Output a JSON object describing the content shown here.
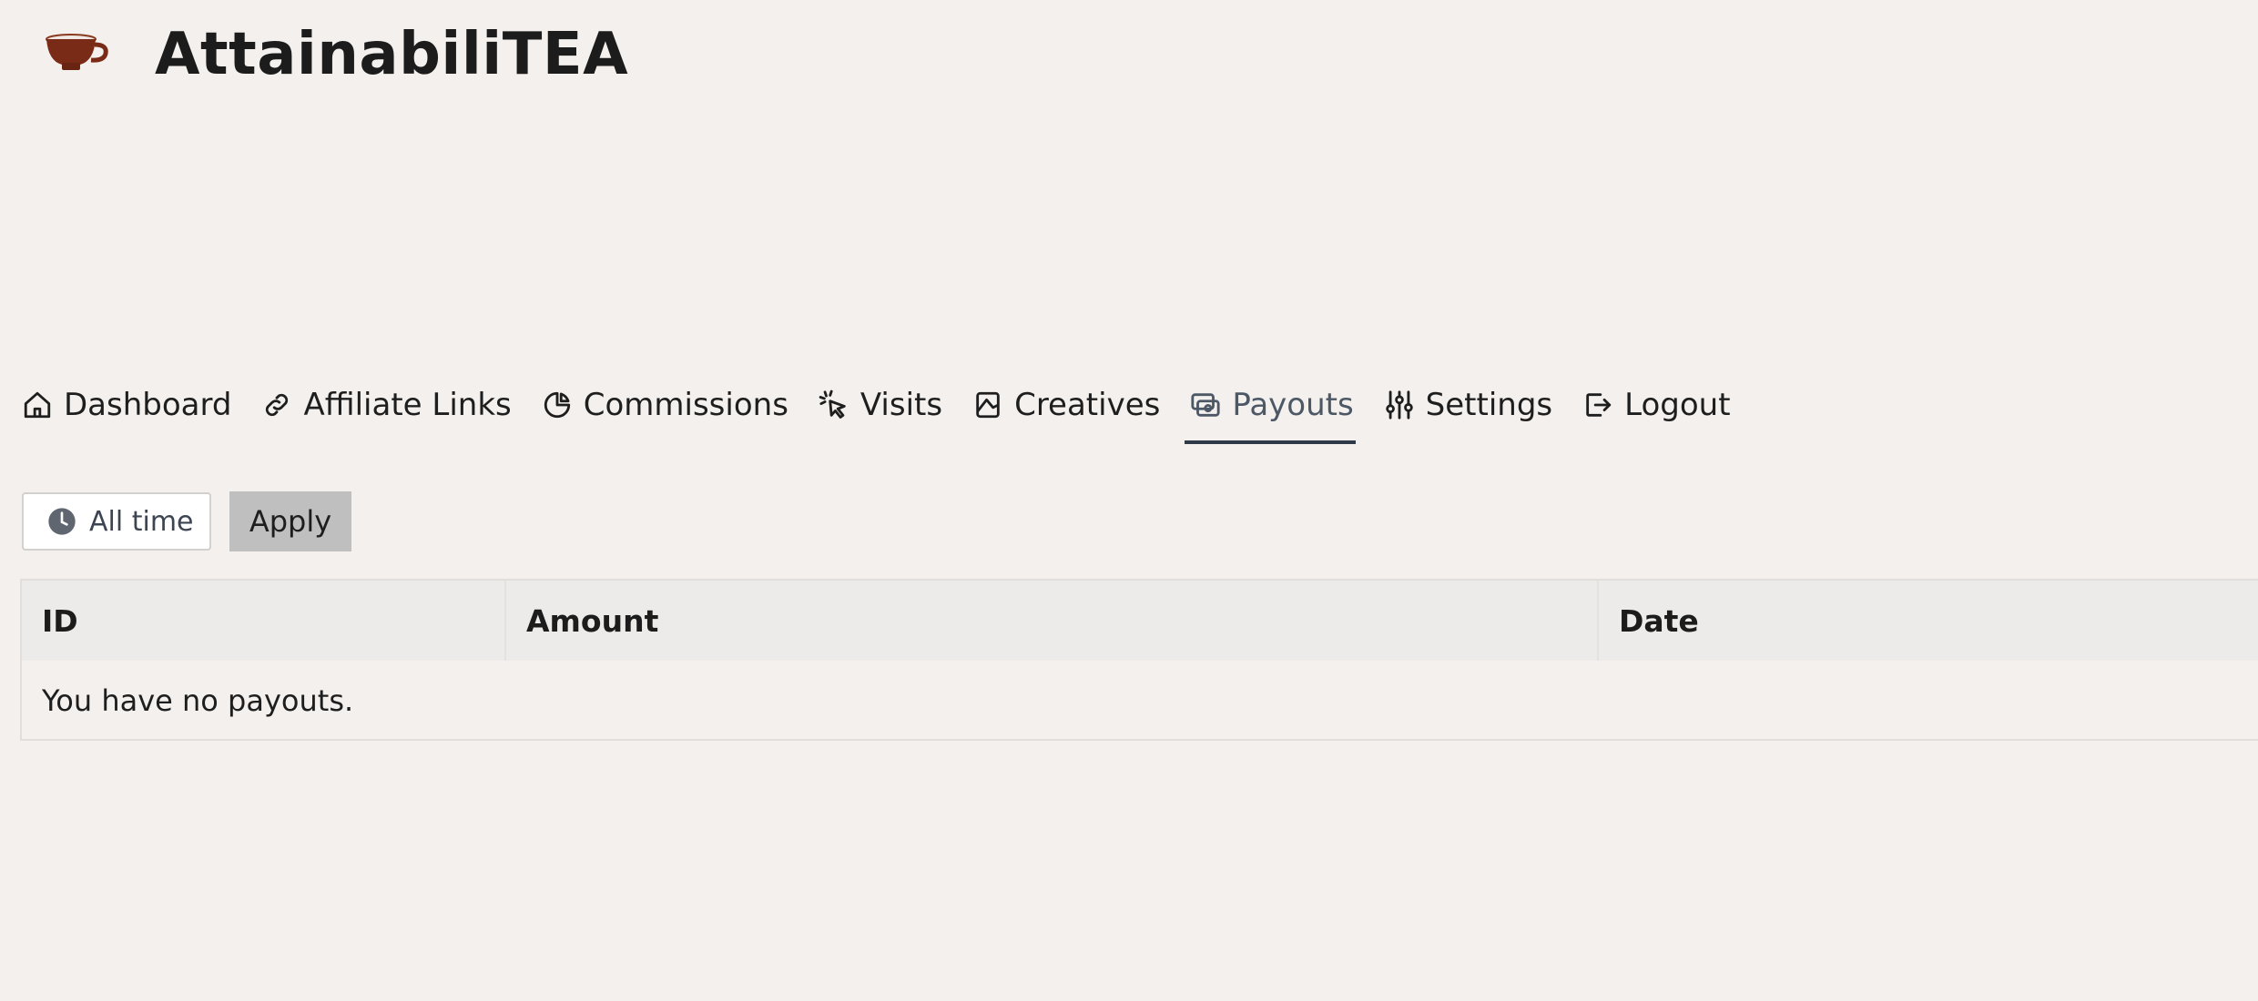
{
  "site": {
    "title": "AttainabiliTEA",
    "logo_icon": "teacup-icon"
  },
  "nav": {
    "items": [
      {
        "label": "Dashboard",
        "icon": "home-icon"
      },
      {
        "label": "Affiliate Links",
        "icon": "link-icon"
      },
      {
        "label": "Commissions",
        "icon": "pie-chart-icon"
      },
      {
        "label": "Visits",
        "icon": "cursor-click-icon"
      },
      {
        "label": "Creatives",
        "icon": "creatives-icon"
      },
      {
        "label": "Payouts",
        "icon": "cash-icon",
        "active": true
      },
      {
        "label": "Settings",
        "icon": "sliders-icon"
      },
      {
        "label": "Logout",
        "icon": "logout-icon"
      }
    ]
  },
  "filter": {
    "date_range": "All time",
    "date_icon": "clock-icon",
    "apply_label": "Apply"
  },
  "table": {
    "columns": [
      "ID",
      "Amount",
      "Date"
    ],
    "empty_message": "You have no payouts."
  },
  "colors": {
    "background": "#f3f0ed",
    "active_tab_underline": "#2f3a48",
    "teacup": "#7a2b17",
    "apply_button": "#bfbfbf"
  }
}
